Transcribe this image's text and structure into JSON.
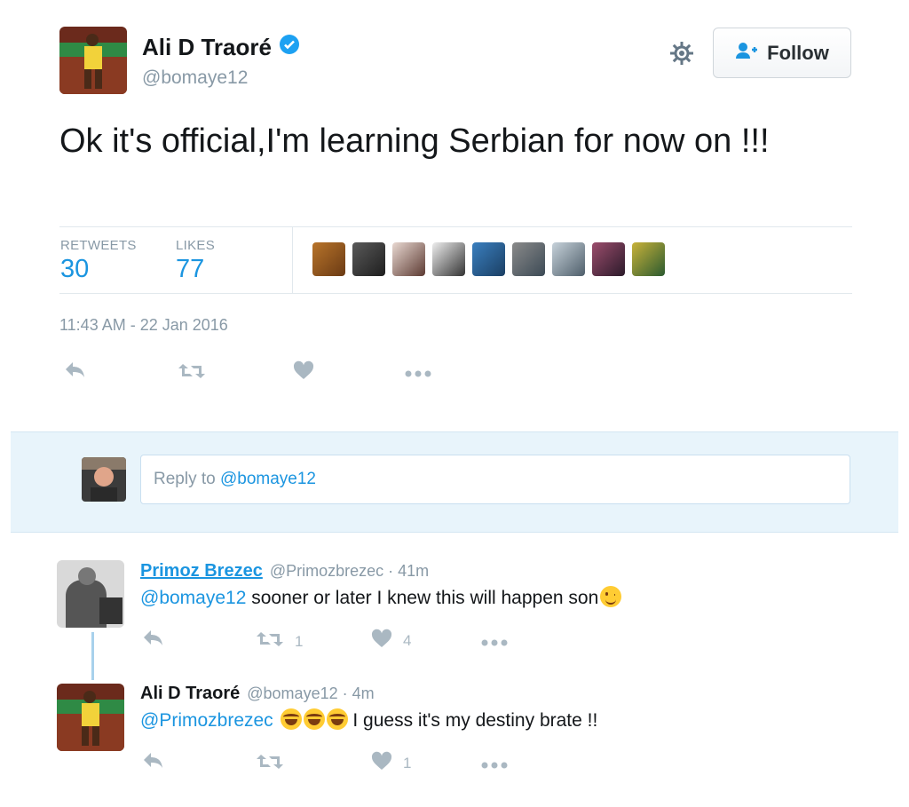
{
  "tweet": {
    "author_name": "Ali D Traoré",
    "author_handle": "@bomaye12",
    "follow_label": "Follow",
    "text": "Ok it's official,I'm learning Serbian for now on !!!",
    "retweets_label": "RETWEETS",
    "retweets_count": "30",
    "likes_label": "LIKES",
    "likes_count": "77",
    "timestamp": "11:43 AM - 22 Jan 2016"
  },
  "reply_box": {
    "prefix": "Reply to ",
    "mention": "@bomaye12"
  },
  "replies": [
    {
      "name": "Primoz Brezec",
      "meta": "@Primozbrezec · 41m",
      "mention": "@bomaye12",
      "text": " sooner or later I knew this will happen son",
      "retweet_count": "1",
      "like_count": "4"
    },
    {
      "name": "Ali D Traoré",
      "meta": "@bomaye12 · 4m",
      "mention": "@Primozbrezec",
      "text": " I guess it's my destiny brate !!",
      "retweet_count": "",
      "like_count": "1"
    }
  ],
  "colors": {
    "accent": "#1b95e0",
    "muted": "#8899a6",
    "verified": "#1da1f2",
    "reply_area_bg": "#e8f4fb"
  },
  "icons": [
    "verified-badge-icon",
    "gear-icon",
    "follow-user-icon",
    "reply-icon",
    "retweet-icon",
    "like-icon",
    "more-icon"
  ]
}
